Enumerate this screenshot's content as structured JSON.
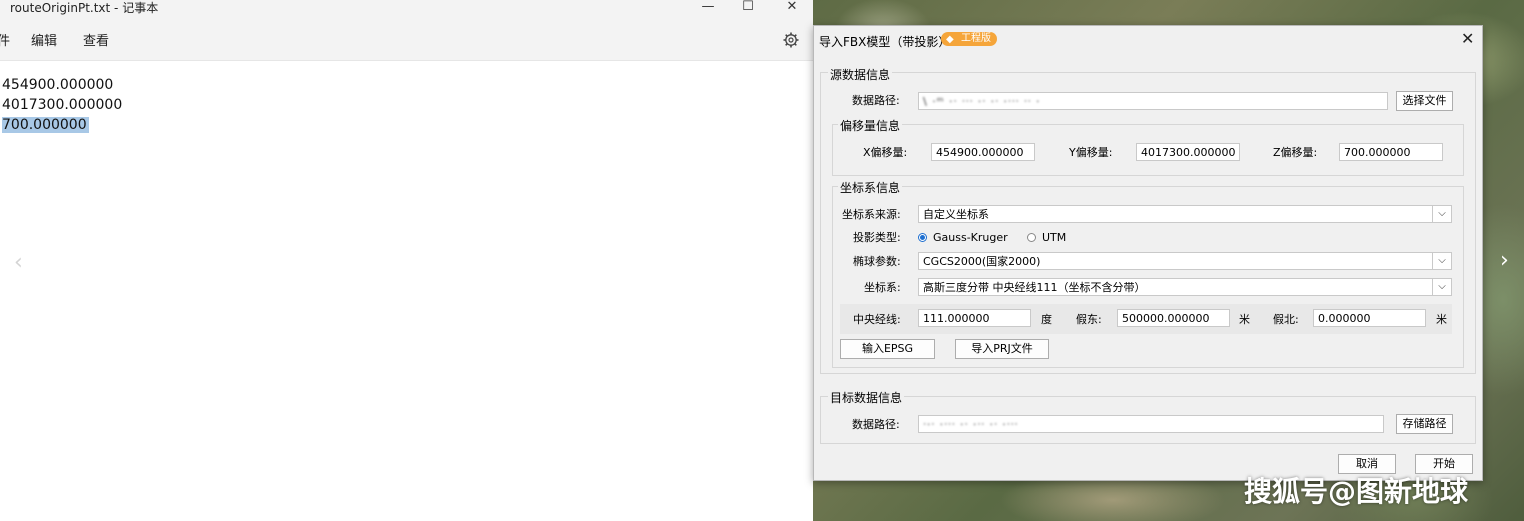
{
  "notepad": {
    "title": "routeOriginPt.txt - 记事本",
    "window_controls": {
      "minimize": "—",
      "maximize": "☐",
      "close": "✕"
    },
    "menu": [
      "件",
      "编辑",
      "查看"
    ],
    "lines": [
      "454900.000000",
      "4017300.000000",
      "700.000000"
    ],
    "prev_glyph": "‹"
  },
  "map": {
    "next_glyph": "›",
    "watermark": "搜狐号@图新地球"
  },
  "dialog": {
    "title": "导入FBX模型（带投影）",
    "badge": "工程版",
    "close_glyph": "✕",
    "source": {
      "legend": "源数据信息",
      "path_label": "数据路径:",
      "path_value": "\\ ·ᵐ ·ᐧ ᐧᐧᐧ ·ᐧ ·ᐧ ·ᐧᐧᐧ ᐧᐧ ·",
      "select_button": "选择文件"
    },
    "offset": {
      "legend": "偏移量信息",
      "x_label": "X偏移量:",
      "x_value": "454900.000000",
      "y_label": "Y偏移量:",
      "y_value": "4017300.000000",
      "z_label": "Z偏移量:",
      "z_value": "700.000000"
    },
    "crs": {
      "legend": "坐标系信息",
      "source_label": "坐标系来源:",
      "source_value": "自定义坐标系",
      "proj_label": "投影类型:",
      "proj_options": [
        "Gauss-Kruger",
        "UTM"
      ],
      "ellipsoid_label": "椭球参数:",
      "ellipsoid_value": "CGCS2000(国家2000)",
      "cs_label": "坐标系:",
      "cs_value": "高斯三度分带 中央经线111（坐标不含分带）",
      "meridian_label": "中央经线:",
      "meridian_value": "111.000000",
      "meridian_unit": "度",
      "false_east_label": "假东:",
      "false_east_value": "500000.000000",
      "false_east_unit": "米",
      "false_north_label": "假北:",
      "false_north_value": "0.000000",
      "false_north_unit": "米",
      "epsg_button": "输入EPSG",
      "prj_button": "导入PRJ文件",
      "dropdown_glyph": "⌵"
    },
    "target": {
      "legend": "目标数据信息",
      "path_label": "数据路径:",
      "path_value": "ᐧ·ᐧ ·ᐧᐧᐧ ·ᐧ ·ᐧᐧ ·ᐧ ·ᐧᐧᐧ",
      "save_button": "存储路径"
    },
    "cancel_button": "取消",
    "start_button": "开始"
  }
}
